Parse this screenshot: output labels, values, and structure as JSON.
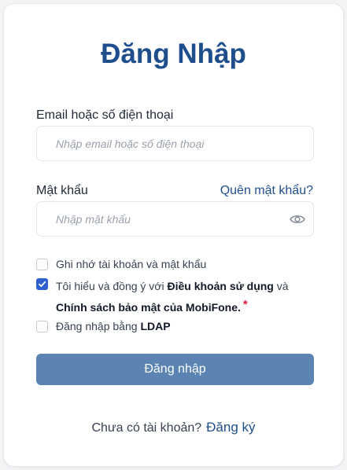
{
  "title": "Đăng Nhập",
  "email": {
    "label": "Email hoặc số điện thoại",
    "placeholder": "Nhập email hoặc số điện thoại",
    "value": ""
  },
  "password": {
    "label": "Mật khẩu",
    "placeholder": "Nhập mật khẩu",
    "value": "",
    "forgot_link": "Quên mật khẩu?",
    "toggle_icon": "eye-icon"
  },
  "options": {
    "remember": {
      "label": "Ghi nhớ tài khoản và mật khẩu",
      "checked": false
    },
    "terms": {
      "text1": "Tôi hiểu và đồng ý với",
      "terms_link": "Điều khoản sử dụng",
      "text2": "và",
      "privacy_link": "Chính sách bảo mật của MobiFone.",
      "required_mark": "*",
      "checked": true
    },
    "ldap": {
      "text": "Đăng nhập bằng",
      "bold": "LDAP",
      "checked": false
    }
  },
  "submit_label": "Đăng nhập",
  "signup": {
    "prompt": "Chưa có tài khoản?",
    "link": "Đăng ký"
  },
  "colors": {
    "accent": "#1f4e8c",
    "button": "#5b84b3",
    "checkbox_checked": "#2f5fcf",
    "required": "#e11d48"
  }
}
